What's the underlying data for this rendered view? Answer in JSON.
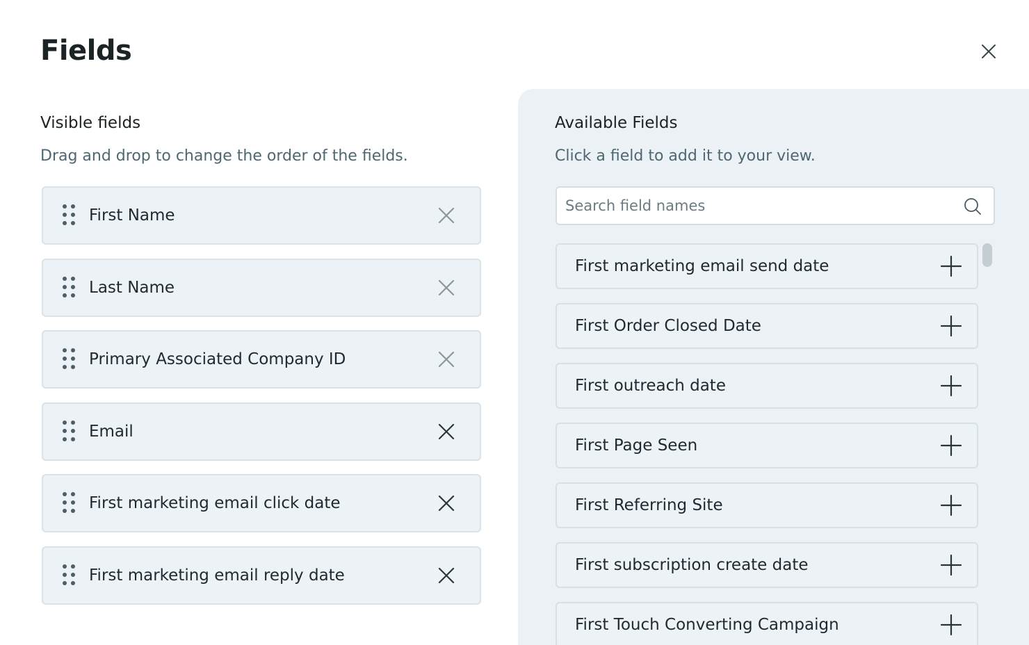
{
  "modal": {
    "title": "Fields",
    "close_icon": "close-icon"
  },
  "visible": {
    "title": "Visible fields",
    "hint": "Drag and drop to change the order of the fields.",
    "fields": [
      {
        "label": "First Name",
        "removable_style": "muted"
      },
      {
        "label": "Last Name",
        "removable_style": "muted"
      },
      {
        "label": "Primary Associated Company ID",
        "removable_style": "muted"
      },
      {
        "label": "Email",
        "removable_style": "active"
      },
      {
        "label": "First marketing email click date",
        "removable_style": "active"
      },
      {
        "label": "First marketing email reply date",
        "removable_style": "active"
      }
    ]
  },
  "available": {
    "title": "Available Fields",
    "hint": "Click a field to add it to your view.",
    "search": {
      "placeholder": "Search field names",
      "value": ""
    },
    "fields": [
      {
        "label": "First marketing email send date"
      },
      {
        "label": "First Order Closed Date"
      },
      {
        "label": "First outreach date"
      },
      {
        "label": "First Page Seen"
      },
      {
        "label": "First Referring Site"
      },
      {
        "label": "First subscription create date"
      },
      {
        "label": "First Touch Converting Campaign"
      }
    ]
  },
  "colors": {
    "panel_bg": "#ebf1f4",
    "field_bg": "#ecf2f5",
    "hint_text": "#4e6873",
    "remove_muted": "#8a979d",
    "remove_active": "#2a3439"
  }
}
